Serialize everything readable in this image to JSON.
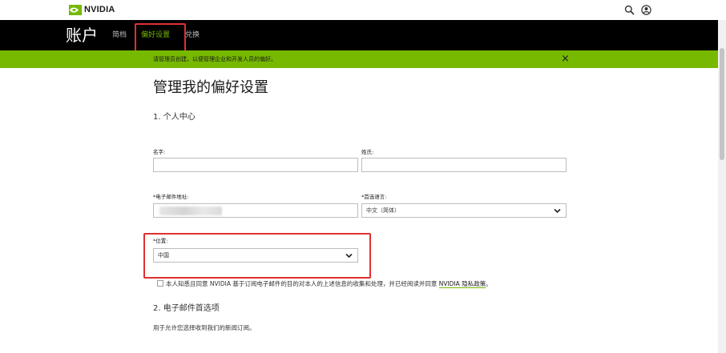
{
  "brand": {
    "logo_text": "NVIDIA",
    "accent_color": "#76b900",
    "logo_icon": "nvidia-eye-icon"
  },
  "header_icons": [
    "search-icon",
    "user-account-icon"
  ],
  "nav": {
    "title": "账户",
    "tabs": [
      {
        "label": "简档"
      },
      {
        "label": "偏好设置",
        "active": true
      },
      {
        "label": "兑换"
      }
    ]
  },
  "banner": {
    "text": "请管理员创建，以便管理企业和开发人员的偏好。",
    "close_label": "×"
  },
  "page": {
    "title": "管理我的偏好设置",
    "section1_title": "1. 个人中心",
    "section2_title": "2. 电子邮件首选项",
    "section2_desc": "用于允许您选择收到我们的新闻订阅。"
  },
  "form": {
    "first_name": {
      "label": "名字:",
      "value": ""
    },
    "last_name": {
      "label": "姓氏:",
      "value": ""
    },
    "email": {
      "label": "*电子邮件地址:",
      "value": ""
    },
    "language": {
      "label": "*首选语言:",
      "value": "中文（简体）"
    },
    "country": {
      "label": "*位置:",
      "value": "中国"
    }
  },
  "consent": {
    "text": "本人知悉且同意 NVIDIA 基于订阅电子邮件的目的对本人的上述信息的收集和处理，并已经阅读并同意 ",
    "link": "NVIDIA 隐私政策",
    "suffix": "。",
    "checked": false
  }
}
